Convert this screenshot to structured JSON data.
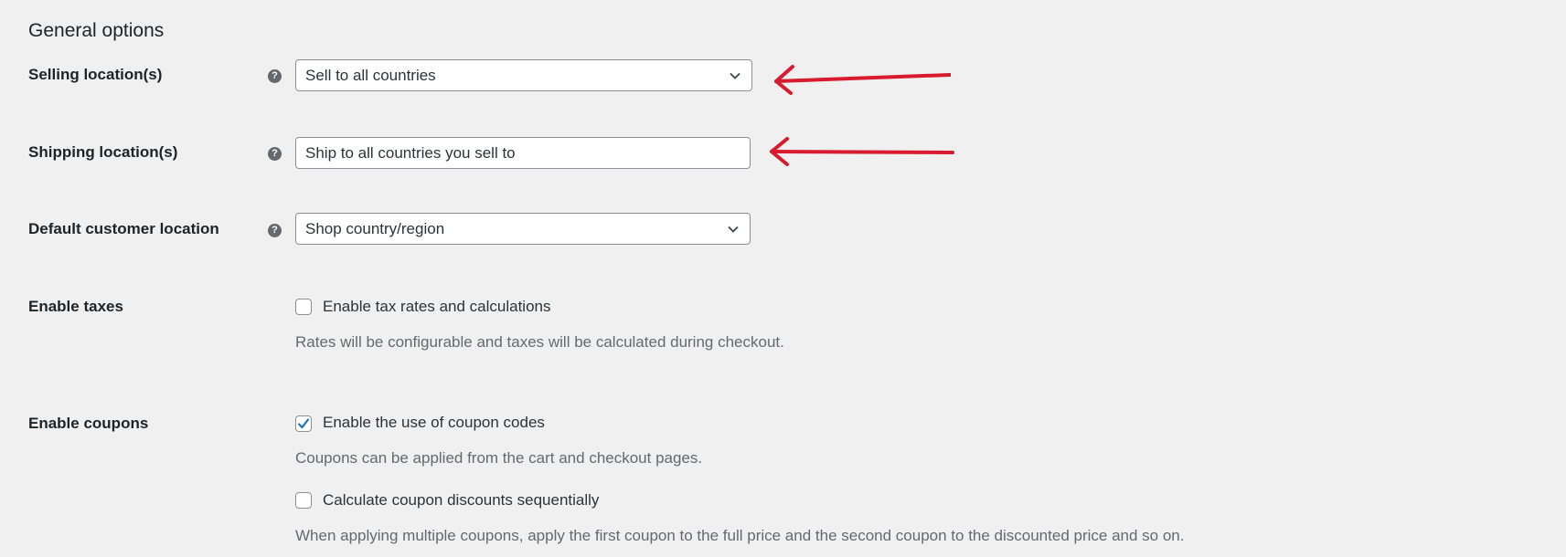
{
  "section": {
    "title": "General options"
  },
  "rows": {
    "selling": {
      "label": "Selling location(s)",
      "value": "Sell to all countries"
    },
    "shipping": {
      "label": "Shipping location(s)",
      "value": "Ship to all countries you sell to"
    },
    "default_location": {
      "label": "Default customer location",
      "value": "Shop country/region"
    },
    "taxes": {
      "label": "Enable taxes",
      "checkbox_label": "Enable tax rates and calculations",
      "checked": false,
      "description": "Rates will be configurable and taxes will be calculated during checkout."
    },
    "coupons": {
      "label": "Enable coupons",
      "checkbox_label": "Enable the use of coupon codes",
      "checked": true,
      "description": "Coupons can be applied from the cart and checkout pages.",
      "sequential_label": "Calculate coupon discounts sequentially",
      "sequential_checked": false,
      "sequential_description": "When applying multiple coupons, apply the first coupon to the full price and the second coupon to the discounted price and so on."
    }
  },
  "help_icon_glyph": "?",
  "colors": {
    "background": "#f0f0f1",
    "checkbox_check": "#2271b1",
    "annotation_arrow": "#d81b2e"
  },
  "icons": {
    "help": "help-icon",
    "dropdown": "chevron-down-icon",
    "check": "checkmark-icon",
    "annotation": "red-arrow-icon"
  }
}
